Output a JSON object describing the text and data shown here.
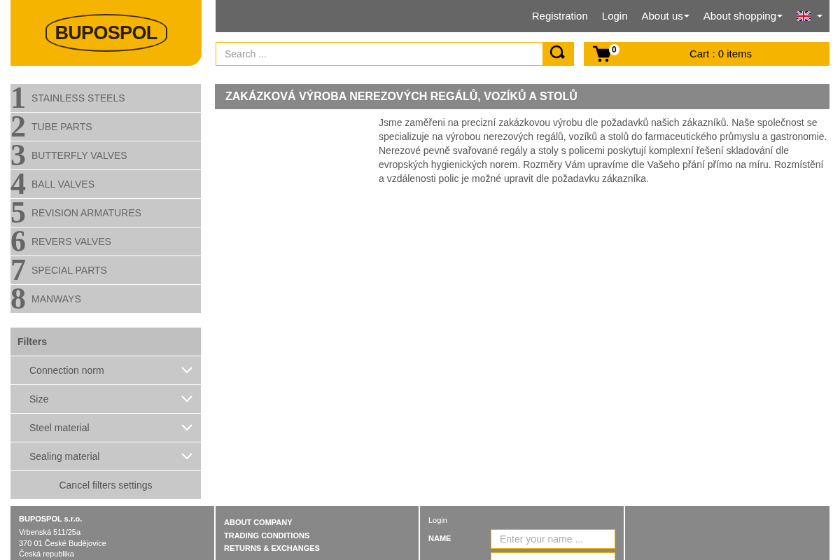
{
  "logo": {
    "text": "BUPOSPOL"
  },
  "nav": [
    {
      "label": "Registration",
      "dropdown": false
    },
    {
      "label": "Login",
      "dropdown": false
    },
    {
      "label": "About us",
      "dropdown": true
    },
    {
      "label": "About shopping",
      "dropdown": true
    }
  ],
  "search": {
    "placeholder": "Search ..."
  },
  "cart": {
    "count": "0",
    "label": "Cart : 0 items"
  },
  "categories": [
    {
      "number": "1",
      "label": "STAINLESS STEELS"
    },
    {
      "number": "2",
      "label": "TUBE PARTS"
    },
    {
      "number": "3",
      "label": "BUTTERFLY VALVES"
    },
    {
      "number": "4",
      "label": "BALL VALVES"
    },
    {
      "number": "5",
      "label": "REVISION ARMATURES"
    },
    {
      "number": "6",
      "label": "REVERS VALVES"
    },
    {
      "number": "7",
      "label": "SPECIAL PARTS"
    },
    {
      "number": "8",
      "label": "MANWAYS"
    }
  ],
  "filters": {
    "title": "Filters",
    "items": [
      {
        "label": "Connection norm",
        "expanded": false
      },
      {
        "label": "Size",
        "expanded": false
      },
      {
        "label": "Steel material",
        "expanded": false
      },
      {
        "label": "Sealing material",
        "expanded": false
      }
    ],
    "cancel": "Cancel filters settings"
  },
  "content": {
    "title": "ZAKÁZKOVÁ VÝROBA NEREZOVÝCH REGÁLŮ, VOZÍKŮ A STOLŮ",
    "text": "Jsme zaměřeni na precizní zakázkovou výrobu dle požadavků našich zákazníků. Naše společnost se specializuje na výrobou nerezových regálů, vozíků a stolů do farmaceutického průmyslu a gastronomie. Nerezové pevně svařované regály a stoly s policemi poskytují komplexní řešení skladování dle evropských hygienických norem. Rozměry Vám upravíme dle Vašeho přání přímo na míru. Rozmístění a vzdálenosti polic je možné upravit dle požadavku zákazníka."
  },
  "footer": {
    "company": {
      "name": "BUPOSPOL s.r.o.",
      "lines": [
        "Vrbenská 511/25a",
        "370 01 České Budějovice",
        "Česká republika"
      ]
    },
    "links": [
      "ABOUT COMPANY",
      "TRADING CONDITIONS",
      "RETURNS & EXCHANGES"
    ],
    "login": {
      "title": "Login",
      "fields": [
        {
          "label": "NAME",
          "placeholder": "Enter your name ..."
        }
      ]
    }
  }
}
